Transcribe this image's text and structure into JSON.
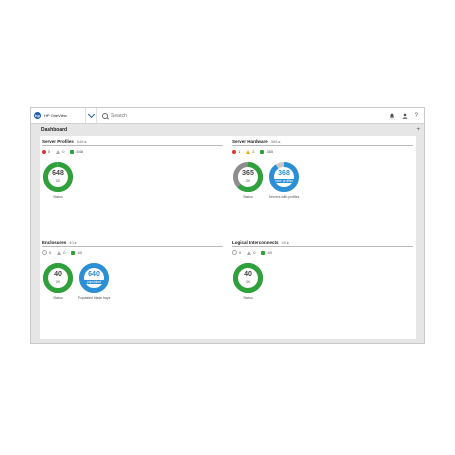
{
  "app": {
    "logo": "hp",
    "name": "HP OneView"
  },
  "search": {
    "placeholder": "Search"
  },
  "topbar_icons": [
    "bell-icon",
    "user-icon",
    "help-icon"
  ],
  "help_glyph": "?",
  "dashboard": {
    "title": "Dashboard",
    "add_symbol": "+"
  },
  "colors": {
    "ok": "#2ea13a",
    "warning": "#e8b400",
    "critical": "#d9382c",
    "info": "#2b8fd6",
    "neutral": "#8d8d8d"
  },
  "panels": {
    "server_profiles": {
      "title": "Server Profiles",
      "count": "648 ▸",
      "status": {
        "critical": "5",
        "warning": "0",
        "ok": "648"
      },
      "donut": {
        "value": "648",
        "subtitle": "OK",
        "label": "Status",
        "ok_fraction": 0.98
      }
    },
    "server_hardware": {
      "title": "Server Hardware",
      "count": "368 ▸",
      "status": {
        "critical": "1",
        "warning": "2",
        "ok": "365"
      },
      "donut": {
        "value": "365",
        "subtitle": "OK",
        "label": "Status",
        "ok_fraction": 0.62
      },
      "donut2": {
        "value": "368",
        "subtitle": "have profiles",
        "label": "Servers with profiles",
        "fraction": 0.9
      }
    },
    "enclosures": {
      "title": "Enclosures",
      "count": "40 ▸",
      "status": {
        "disabled": "0",
        "warning": "0",
        "ok": "40"
      },
      "donut": {
        "value": "40",
        "subtitle": "OK",
        "label": "Status",
        "ok_fraction": 1.0
      },
      "donut2": {
        "value": "640",
        "subtitle": "populated",
        "label": "Populated blade bays",
        "fraction": 1.0
      }
    },
    "logical_interconnects": {
      "title": "Logical Interconnects",
      "count": "40 ▸",
      "status": {
        "disabled": "0",
        "warning": "0",
        "ok": "40"
      },
      "donut": {
        "value": "40",
        "subtitle": "OK",
        "label": "Status",
        "ok_fraction": 1.0
      }
    }
  }
}
